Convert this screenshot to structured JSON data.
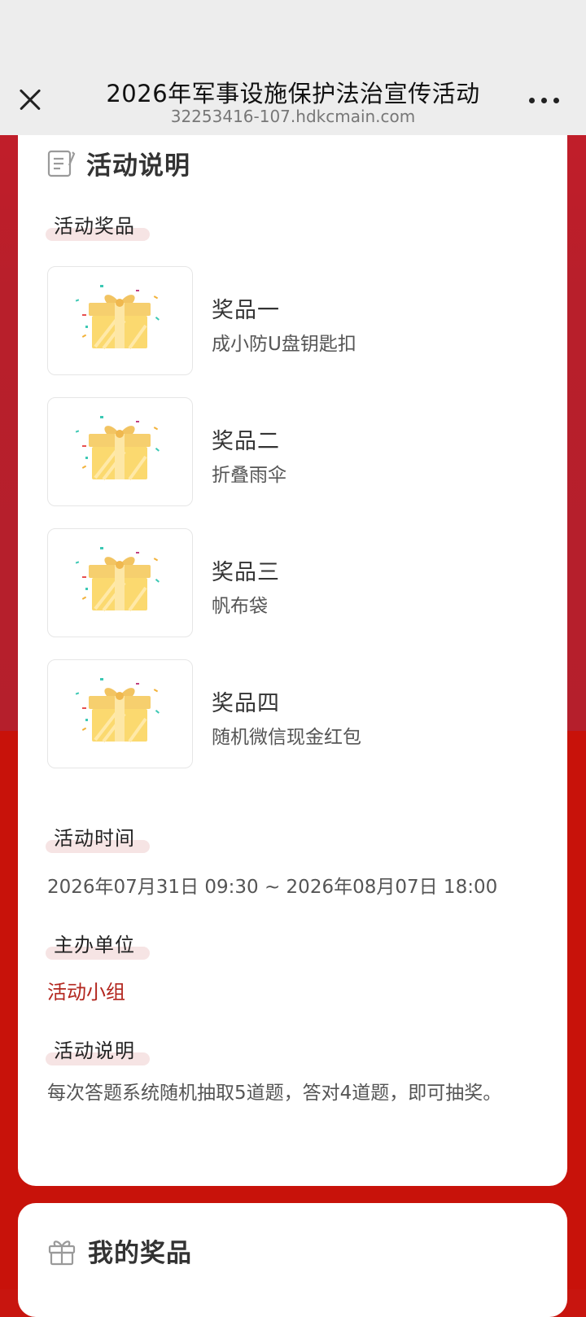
{
  "browser": {
    "title": "2026年军事设施保护法治宣传活动",
    "url": "32253416-107.hdkcmain.com"
  },
  "activity": {
    "section_title": "活动说明",
    "prizes_label": "活动奖品",
    "prizes": [
      {
        "name": "奖品一",
        "desc": "成小防U盘钥匙扣"
      },
      {
        "name": "奖品二",
        "desc": "折叠雨伞"
      },
      {
        "name": "奖品三",
        "desc": "帆布袋"
      },
      {
        "name": "奖品四",
        "desc": "随机微信现金红包"
      }
    ],
    "time_label": "活动时间",
    "time_value": "2026年07月31日 09:30 ~ 2026年08月07日 18:00",
    "organizer_label": "主办单位",
    "organizer_value": "活动小组",
    "desc_label": "活动说明",
    "desc_value": "每次答题系统随机抽取5道题，答对4道题，即可抽奖。"
  },
  "my_prizes": {
    "section_title": "我的奖品"
  },
  "colors": {
    "accent": "#b3261e",
    "background": "#c8120a",
    "pill": "#f6e4e4"
  }
}
